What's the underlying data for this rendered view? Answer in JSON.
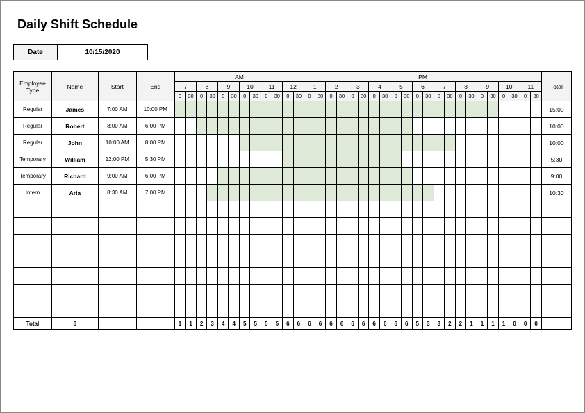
{
  "title": "Daily Shift Schedule",
  "date_label": "Date",
  "date_value": "10/15/2020",
  "headers": {
    "etype": "Employee Type",
    "name": "Name",
    "start": "Start",
    "end": "End",
    "am": "AM",
    "pm": "PM",
    "total": "Total",
    "hours_am": [
      "7",
      "8",
      "9",
      "10",
      "11",
      "12"
    ],
    "hours_pm": [
      "1",
      "2",
      "3",
      "4",
      "5",
      "6",
      "7",
      "8",
      "9",
      "10",
      "11"
    ],
    "subs": [
      "0",
      "30"
    ]
  },
  "rows": [
    {
      "etype": "Regular",
      "name": "James",
      "start": "7:00 AM",
      "end": "10:00 PM",
      "total": "15:00",
      "fill": [
        0,
        29
      ]
    },
    {
      "etype": "Regular",
      "name": "Robert",
      "start": "8:00 AM",
      "end": "6:00 PM",
      "total": "10:00",
      "fill": [
        2,
        21
      ]
    },
    {
      "etype": "Regular",
      "name": "John",
      "start": "10:00 AM",
      "end": "8:00 PM",
      "total": "10:00",
      "fill": [
        6,
        25
      ]
    },
    {
      "etype": "Temporary",
      "name": "William",
      "start": "12:00 PM",
      "end": "5:30 PM",
      "total": "5:30",
      "fill": [
        10,
        20
      ]
    },
    {
      "etype": "Temporary",
      "name": "Richard",
      "start": "9:00 AM",
      "end": "6:00 PM",
      "total": "9:00",
      "fill": [
        4,
        21
      ]
    },
    {
      "etype": "Intern",
      "name": "Aria",
      "start": "8:30 AM",
      "end": "7:00 PM",
      "total": "10:30",
      "fill": [
        3,
        23
      ]
    },
    {
      "etype": "",
      "name": "",
      "start": "",
      "end": "",
      "total": "",
      "fill": null
    },
    {
      "etype": "",
      "name": "",
      "start": "",
      "end": "",
      "total": "",
      "fill": null
    },
    {
      "etype": "",
      "name": "",
      "start": "",
      "end": "",
      "total": "",
      "fill": null
    },
    {
      "etype": "",
      "name": "",
      "start": "",
      "end": "",
      "total": "",
      "fill": null
    },
    {
      "etype": "",
      "name": "",
      "start": "",
      "end": "",
      "total": "",
      "fill": null
    },
    {
      "etype": "",
      "name": "",
      "start": "",
      "end": "",
      "total": "",
      "fill": null
    },
    {
      "etype": "",
      "name": "",
      "start": "",
      "end": "",
      "total": "",
      "fill": null
    }
  ],
  "footer": {
    "label": "Total",
    "count": "6",
    "slots": [
      "1",
      "1",
      "2",
      "3",
      "4",
      "4",
      "5",
      "5",
      "5",
      "5",
      "6",
      "6",
      "6",
      "6",
      "6",
      "6",
      "6",
      "6",
      "6",
      "6",
      "6",
      "6",
      "5",
      "3",
      "3",
      "2",
      "2",
      "1",
      "1",
      "1",
      "1",
      "0",
      "0",
      "0"
    ],
    "total": ""
  }
}
